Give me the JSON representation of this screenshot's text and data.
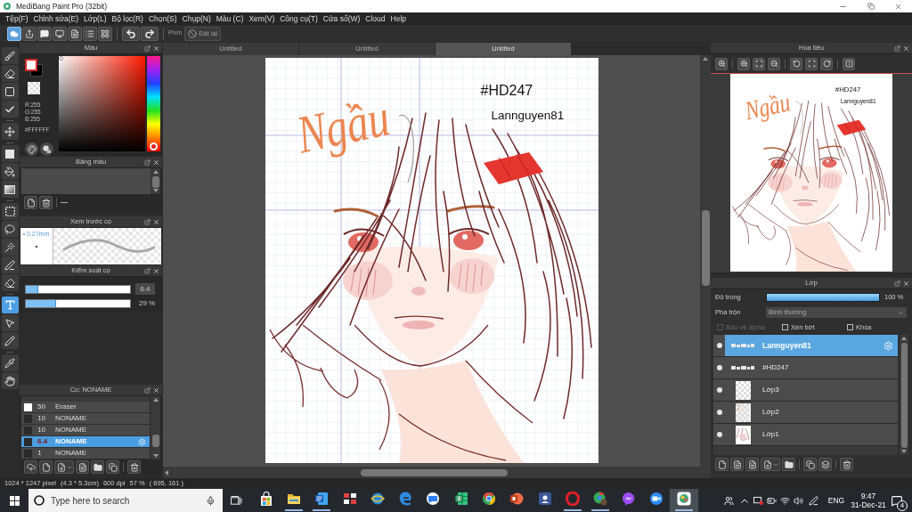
{
  "window": {
    "title": "MediBang Paint Pro (32bit)"
  },
  "menu": [
    "Tệp(F)",
    "Chỉnh sửa(E)",
    "Lớp(L)",
    "Bộ lọc(R)",
    "Chọn(S)",
    "Chụp(N)",
    "Màu (C)",
    "Xem(V)",
    "Công cụ(T)",
    "Cửa sổ(W)",
    "Cloud",
    "Help"
  ],
  "toolbar": {
    "groups": [
      [
        {
          "kind": "cloud",
          "selected": true
        },
        {
          "kind": "export",
          "selected": false
        },
        {
          "kind": "comment",
          "selected": false
        },
        {
          "kind": "screen",
          "selected": false
        },
        {
          "kind": "page",
          "selected": false
        },
        {
          "kind": "list",
          "selected": false
        },
        {
          "kind": "grid",
          "selected": false
        }
      ],
      [
        {
          "kind": "undo",
          "selected": false
        },
        {
          "kind": "redo",
          "selected": false
        }
      ]
    ],
    "shortcut_label": "Phím",
    "reset_button": "Đặt lại"
  },
  "tools": [
    [
      {
        "kind": "brush",
        "selected": false
      },
      {
        "kind": "eraser",
        "selected": false
      },
      {
        "kind": "dot",
        "selected": false
      },
      {
        "kind": "edit",
        "selected": false
      }
    ],
    [
      {
        "kind": "move",
        "selected": false
      }
    ],
    [
      {
        "kind": "fill",
        "selected": false
      },
      {
        "kind": "bucket",
        "selected": false
      },
      {
        "kind": "gradient",
        "selected": false
      }
    ],
    [
      {
        "kind": "select",
        "selected": false
      },
      {
        "kind": "lasso",
        "selected": false
      },
      {
        "kind": "wand",
        "selected": false
      },
      {
        "kind": "select-pen",
        "selected": false
      },
      {
        "kind": "select-eraser",
        "selected": false
      }
    ],
    [
      {
        "kind": "text",
        "selected": true
      },
      {
        "kind": "operation",
        "selected": false
      },
      {
        "kind": "divide",
        "selected": false
      }
    ],
    [
      {
        "kind": "eyedropper",
        "selected": false
      },
      {
        "kind": "hand",
        "selected": false
      }
    ]
  ],
  "color_panel": {
    "title": "Màu",
    "rgb": [
      "R:255",
      "G:255",
      "B:255"
    ],
    "hex": "#FFFFFF",
    "hue": {
      "level": 0
    }
  },
  "palette_panel": {
    "title": "Bảng màu"
  },
  "brush_preview": {
    "title": "Xem trước cọ",
    "size": "0.27mm"
  },
  "brush_control": {
    "title": "Kiểm soát cọ",
    "sliders": [
      {
        "kind": "size",
        "level": 0.12,
        "reading": "6.4"
      },
      {
        "kind": "opacity",
        "level": 0.29,
        "reading": "29 %"
      }
    ]
  },
  "brush_panel": {
    "title": "Cọ: NONAME",
    "brushes": [
      {
        "size": "50",
        "name": "Eraser",
        "color": "#ffffff",
        "selected": false
      },
      {
        "size": "10",
        "name": "NONAME",
        "color": "#2a2a2a",
        "selected": false
      },
      {
        "size": "10",
        "name": "NONAME",
        "color": "#2a2a2a",
        "selected": false
      },
      {
        "size": "6.4",
        "name": "NONAME",
        "color": "#2a2a2a",
        "selected": true
      },
      {
        "size": "1",
        "name": "NONAME",
        "color": "#2a2a2a",
        "selected": false
      }
    ]
  },
  "tabs": [
    {
      "label": "Untitled",
      "selected": false
    },
    {
      "label": "Untitled",
      "selected": false
    },
    {
      "label": "Untitled",
      "selected": true
    }
  ],
  "canvas": {
    "texts": [
      {
        "kind": "handwriting",
        "text": "Ngầu"
      },
      {
        "kind": "tag",
        "text": "#HD247"
      },
      {
        "kind": "signature",
        "text": "Lannguyen81"
      }
    ]
  },
  "navigator": {
    "title": "Hoa tiêu",
    "texts": [
      {
        "kind": "handwriting",
        "text": "Ngầu"
      },
      {
        "kind": "tag",
        "text": "#HD247"
      },
      {
        "kind": "signature",
        "text": "Lannguyen81"
      }
    ]
  },
  "layers_panel": {
    "title": "Lớp",
    "opacity_label": "Độ trong",
    "opacity": {
      "level": 1,
      "reading": "100 %"
    },
    "blend_label": "Pha trộn",
    "blend_mode": "Bình thường",
    "options": [
      {
        "label": "Bảo vệ alpha",
        "checked": false,
        "disabled": true
      },
      {
        "label": "Xén bớt",
        "checked": false,
        "disabled": false
      },
      {
        "label": "Khóa",
        "checked": false,
        "disabled": false
      }
    ],
    "layers": [
      {
        "name": "Lannguyen81",
        "kind": "text",
        "visible": true,
        "selected": true
      },
      {
        "name": "#HD247",
        "kind": "text",
        "visible": true,
        "selected": false
      },
      {
        "name": "Lớp3",
        "kind": "blank",
        "visible": true,
        "selected": false
      },
      {
        "name": "Lớp2",
        "kind": "mark",
        "visible": true,
        "selected": false
      },
      {
        "name": "Lớp1",
        "kind": "sketch",
        "visible": true,
        "selected": false
      }
    ]
  },
  "status_bar": [
    "1024 * 1247 pixel",
    "(4.3 * 5.3cm)",
    "600 dpi",
    "57 %",
    "( 695, 161 )"
  ],
  "taskbar": {
    "search_placeholder": "Type here to search",
    "apps": [
      {
        "kind": "store",
        "running": false,
        "selected": false
      },
      {
        "kind": "explorer",
        "running": true,
        "selected": false
      },
      {
        "kind": "word",
        "running": true,
        "selected": false
      },
      {
        "kind": "red-app",
        "running": false,
        "selected": false
      },
      {
        "kind": "globe",
        "running": false,
        "selected": false
      },
      {
        "kind": "edge",
        "running": false,
        "selected": false
      },
      {
        "kind": "zalo",
        "running": false,
        "selected": false
      },
      {
        "kind": "excel",
        "running": false,
        "selected": false
      },
      {
        "kind": "chrome",
        "running": false,
        "selected": false
      },
      {
        "kind": "powerpoint",
        "running": false,
        "selected": false
      },
      {
        "kind": "facebook",
        "running": false,
        "selected": false
      },
      {
        "kind": "opera",
        "running": true,
        "selected": false
      },
      {
        "kind": "chrome-profile",
        "running": true,
        "selected": false
      },
      {
        "kind": "messenger",
        "running": false,
        "selected": false
      },
      {
        "kind": "zoom",
        "running": false,
        "selected": false
      },
      {
        "kind": "medibang",
        "running": true,
        "selected": true
      }
    ],
    "language": "ENG",
    "time": "9:47",
    "date": "31-Dec-21",
    "notification_count": "4"
  }
}
